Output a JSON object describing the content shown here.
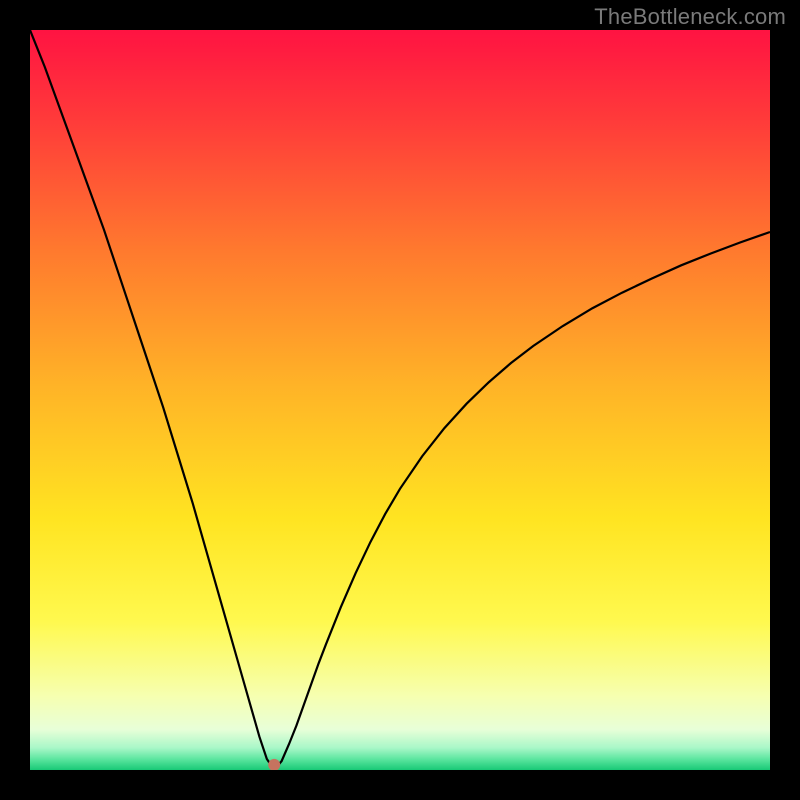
{
  "watermark": "TheBottleneck.com",
  "chart_data": {
    "type": "line",
    "title": "",
    "xlabel": "",
    "ylabel": "",
    "xlim": [
      0,
      100
    ],
    "ylim": [
      0,
      100
    ],
    "grid": false,
    "legend": false,
    "background": {
      "type": "vertical-gradient",
      "stops": [
        {
          "pos": 0.0,
          "color": "#ff1342"
        },
        {
          "pos": 0.12,
          "color": "#ff3a3a"
        },
        {
          "pos": 0.3,
          "color": "#ff7a2e"
        },
        {
          "pos": 0.48,
          "color": "#ffb327"
        },
        {
          "pos": 0.66,
          "color": "#ffe421"
        },
        {
          "pos": 0.8,
          "color": "#fff94f"
        },
        {
          "pos": 0.9,
          "color": "#f6ffb0"
        },
        {
          "pos": 0.945,
          "color": "#e8ffd8"
        },
        {
          "pos": 0.97,
          "color": "#a9f7c8"
        },
        {
          "pos": 0.985,
          "color": "#5de6a0"
        },
        {
          "pos": 1.0,
          "color": "#18c976"
        }
      ]
    },
    "series": [
      {
        "name": "curve",
        "stroke": "#000000",
        "stroke_width": 2.2,
        "x": [
          0.0,
          2.0,
          4.0,
          6.0,
          8.0,
          10.0,
          12.0,
          14.0,
          16.0,
          18.0,
          20.0,
          22.0,
          24.0,
          26.0,
          28.0,
          30.0,
          31.0,
          32.0,
          33.0,
          34.0,
          35.0,
          36.0,
          37.0,
          38.0,
          39.0,
          40.0,
          42.0,
          44.0,
          46.0,
          48.0,
          50.0,
          53.0,
          56.0,
          59.0,
          62.0,
          65.0,
          68.0,
          72.0,
          76.0,
          80.0,
          84.0,
          88.0,
          92.0,
          96.0,
          100.0
        ],
        "y": [
          100.0,
          95.0,
          89.5,
          84.0,
          78.5,
          73.0,
          67.0,
          61.0,
          55.0,
          49.0,
          42.5,
          36.0,
          29.0,
          22.0,
          15.0,
          8.0,
          4.5,
          1.5,
          0.0,
          1.2,
          3.5,
          6.0,
          8.8,
          11.6,
          14.4,
          17.0,
          22.0,
          26.6,
          30.8,
          34.6,
          38.0,
          42.4,
          46.2,
          49.5,
          52.4,
          55.0,
          57.3,
          60.0,
          62.4,
          64.5,
          66.4,
          68.2,
          69.8,
          71.3,
          72.7
        ]
      }
    ],
    "marker": {
      "x": 33.0,
      "y": 0.7,
      "radius": 6,
      "fill": "#c6735f"
    }
  }
}
